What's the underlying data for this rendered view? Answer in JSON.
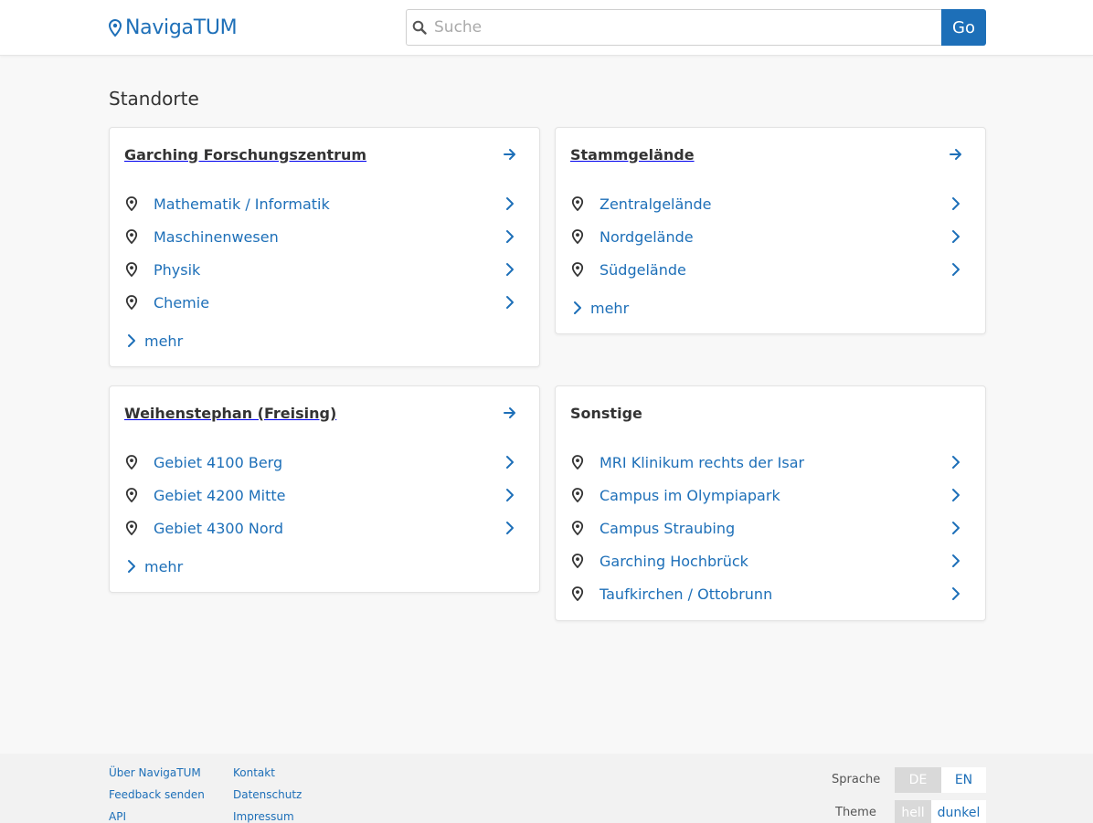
{
  "header": {
    "logo_text": "NavigaTUM",
    "search_placeholder": "Suche",
    "search_value": "",
    "go_label": "Go"
  },
  "main": {
    "title": "Standorte",
    "mehr_label": "mehr",
    "cards": [
      {
        "title": "Garching Forschungszentrum",
        "has_head_link": true,
        "items": [
          "Mathematik / Informatik",
          "Maschinenwesen",
          "Physik",
          "Chemie"
        ],
        "has_mehr": true
      },
      {
        "title": "Stammgelände",
        "has_head_link": true,
        "items": [
          "Zentralgelände",
          "Nordgelände",
          "Südgelände"
        ],
        "has_mehr": true
      },
      {
        "title": "Weihenstephan (Freising)",
        "has_head_link": true,
        "items": [
          "Gebiet 4100 Berg",
          "Gebiet 4200 Mitte",
          "Gebiet 4300 Nord"
        ],
        "has_mehr": true
      },
      {
        "title": "Sonstige",
        "has_head_link": false,
        "items": [
          "MRI Klinikum rechts der Isar",
          "Campus im Olympiapark",
          "Campus Straubing",
          "Garching Hochbrück",
          "Taufkirchen / Ottobrunn"
        ],
        "has_mehr": false
      }
    ]
  },
  "footer": {
    "links_col1": [
      "Über NavigaTUM",
      "Feedback senden",
      "API"
    ],
    "links_col2": [
      "Kontakt",
      "Datenschutz",
      "Impressum"
    ],
    "language_label": "Sprache",
    "language_options": [
      "DE",
      "EN"
    ],
    "language_selected": "DE",
    "theme_label": "Theme",
    "theme_options": [
      "hell",
      "dunkel"
    ],
    "theme_selected": "hell"
  },
  "colors": {
    "accent": "#1d6fb8",
    "background": "#f8f8f8",
    "card": "#ffffff",
    "footer": "#f2f2f2"
  },
  "icons": {
    "logo": "map-pin-icon",
    "search": "search-icon",
    "card_head": "arrow-right-icon",
    "item_lead": "location-pin-icon",
    "item_trail": "chevron-right-icon"
  }
}
